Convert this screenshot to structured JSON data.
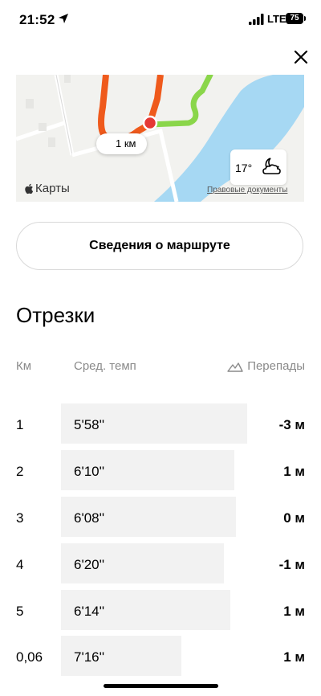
{
  "status_bar": {
    "time": "21:52",
    "network": "LTE",
    "battery": "75"
  },
  "map": {
    "distance_label": "1 км",
    "weather_temp": "17°",
    "maps_logo_text": "Карты",
    "legal_link": "Правовые документы"
  },
  "route_button_label": "Сведения о маршруте",
  "splits": {
    "title": "Отрезки",
    "headers": {
      "km": "Км",
      "pace": "Сред. темп",
      "elevation": "Перепады"
    },
    "rows": [
      {
        "km": "1",
        "pace": "5'58''",
        "pace_seconds": 358,
        "elevation": "-3 м"
      },
      {
        "km": "2",
        "pace": "6'10''",
        "pace_seconds": 370,
        "elevation": "1 м"
      },
      {
        "km": "3",
        "pace": "6'08''",
        "pace_seconds": 368,
        "elevation": "0 м"
      },
      {
        "km": "4",
        "pace": "6'20''",
        "pace_seconds": 380,
        "elevation": "-1 м"
      },
      {
        "km": "5",
        "pace": "6'14''",
        "pace_seconds": 374,
        "elevation": "1 м"
      },
      {
        "km": "0,06",
        "pace": "7'16''",
        "pace_seconds": 436,
        "elevation": "1 м"
      }
    ]
  },
  "colors": {
    "river": "#a6d8f3",
    "route_orange": "#ef5a1c",
    "route_green": "#8ad64a",
    "pin_red": "#e53935"
  }
}
